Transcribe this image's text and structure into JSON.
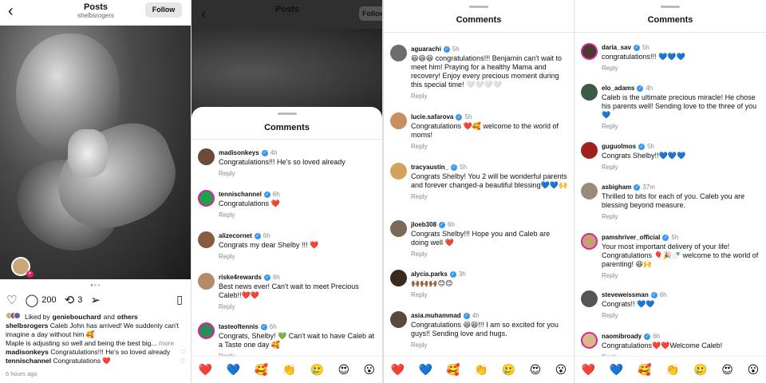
{
  "post": {
    "title": "Posts",
    "username": "shelbsrogers",
    "follow_label": "Follow",
    "comment_count": "200",
    "share_count": "3",
    "liked_by_prefix": "Liked by",
    "liked_by_user": "geniebouchard",
    "liked_by_suffix": "and",
    "liked_by_others": "others",
    "caption_user": "shelbsrogers",
    "caption_text": "Caleb John has arrived! We suddenly can't imagine a day without him 🥰",
    "caption_line2": "Maple is adjusting so well and being the best big...",
    "caption_more": "more",
    "preview": [
      {
        "user": "madisonkeys",
        "text": "Congratulations!!! He's so loved already"
      },
      {
        "user": "tennischannel",
        "text": "Congratulations ❤️"
      }
    ],
    "time": "6 hours ago"
  },
  "sheet_title": "Comments",
  "reply_label": "Reply",
  "panel2": [
    {
      "user": "madisonkeys",
      "time": "4h",
      "text": "Congratulations!!! He's so loved already",
      "color": "#6b4a3a"
    },
    {
      "user": "tennischannel",
      "time": "6h",
      "text": "Congratulations ❤️",
      "color": "#1aa34a"
    },
    {
      "user": "alizecornet",
      "time": "6h",
      "text": "Congrats my dear Shelby !!! ❤️",
      "color": "#8a5a44"
    },
    {
      "user": "riske4rewards",
      "time": "6h",
      "text": "Best news ever! Can't wait to meet Precious Caleb!!❤️❤️",
      "color": "#b48a6a"
    },
    {
      "user": "tasteoftennis",
      "time": "6h",
      "text": "Congrats, Shelby! 💚 Can't wait to have Caleb at a Taste one day 🥰",
      "color": "#2e8b57"
    }
  ],
  "panel3": [
    {
      "user": "aguarachi",
      "time": "5h",
      "text": "😆😆😆 congratulations!!! Benjamin can't wait to meet him! Praying for a healthy Mama and recovery! Enjoy every precious moment during this special time! 🤍🤍🤍🤍",
      "color": "#6d6d6d"
    },
    {
      "user": "lucie.safarova",
      "time": "5h",
      "text": "Congratulations ❤️🥰 welcome to the world of moms!",
      "color": "#c98e5e"
    },
    {
      "user": "tracyaustin_",
      "time": "5h",
      "text": "Congrats Shelby! You 2 will be wonderful parents and forever changed-a beautiful blessing💙💙🙌",
      "color": "#d3a35a"
    },
    {
      "user": "jloeb308",
      "time": "6h",
      "text": "Congrats Shelby!!! Hope you and Caleb are doing well ❤️",
      "color": "#7a6a5a"
    },
    {
      "user": "alycia.parks",
      "time": "3h",
      "text": "🙌🏾🙌🏾🙌🏾😊😊",
      "color": "#3a2a1e"
    },
    {
      "user": "asia.muhammad",
      "time": "4h",
      "text": "Congratulations 😆😆!!! I am so excited for you guys!! Sending love and hugs.",
      "color": "#5a4a3e"
    }
  ],
  "panel4": [
    {
      "user": "daria_sav",
      "time": "5h",
      "text": "congratulations!!! 💙💙💙",
      "color": "#4a3a30"
    },
    {
      "user": "elo_adams",
      "time": "4h",
      "text": "Caleb is the ultimate precious miracle! He chose his parents well! Sending love to the three of you 💙",
      "color": "#3c5a44"
    },
    {
      "user": "guguolmos",
      "time": "5h",
      "text": "Congrats Shelby!!💙💙💙",
      "color": "#a0201e"
    },
    {
      "user": "asbigham",
      "time": "37m",
      "text": "Thrilled to bits for each of you. Caleb you are blessing beyond measure.",
      "color": "#9a8a7a"
    },
    {
      "user": "pamshriver_official",
      "time": "5h",
      "text": "Your most important delivery of your life! Congratulations 🎈🎉🍼 welcome to the world of parenting! 😆🙌",
      "color": "#c8a070"
    },
    {
      "user": "steveweissman",
      "time": "6h",
      "text": "Congrats!! 💙💙",
      "color": "#555555"
    },
    {
      "user": "naomibroady",
      "time": "6h",
      "text": "Congratulations❤️❤️Welcome Caleb!",
      "color": "#d9b88a"
    }
  ],
  "emojis": [
    "❤️",
    "💙",
    "🥰",
    "👏",
    "🥲",
    "😍",
    "😮"
  ]
}
